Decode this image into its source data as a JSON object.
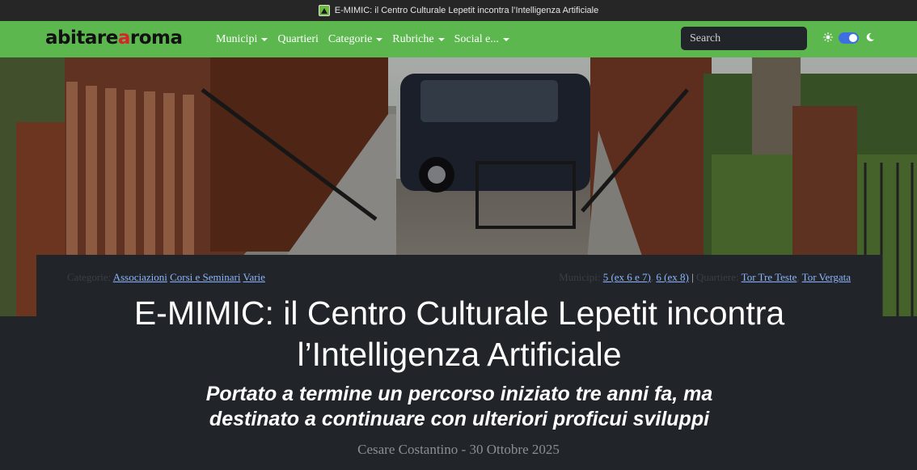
{
  "browser": {
    "tab_title": "E-MIMIC: il Centro Culturale Lepetit incontra l’Intelligenza Artificiale"
  },
  "navbar": {
    "logo_part1": "abitare",
    "logo_a": "a",
    "logo_part2": "roma",
    "items": [
      {
        "label": "Municipi",
        "dropdown": true
      },
      {
        "label": "Quartieri",
        "dropdown": false
      },
      {
        "label": "Categorie",
        "dropdown": true
      },
      {
        "label": "Rubriche",
        "dropdown": true
      },
      {
        "label": "Social e...",
        "dropdown": true
      }
    ],
    "search_placeholder": "Search",
    "theme_dark": true,
    "colors": {
      "bar": "#5cb84e",
      "logo_accent": "#d9232b",
      "toggle": "#3d6fe0"
    }
  },
  "article": {
    "categories_label": "Categorie:",
    "categories": [
      "Associazioni",
      "Corsi e Seminari",
      "Varie"
    ],
    "municipi_label": "Municipi:",
    "municipi": [
      "5 (ex 6 e 7)",
      "6 (ex 8)"
    ],
    "divider": "|",
    "quartieri_label": "Quartiere:",
    "quartieri": [
      "Tor Tre Teste",
      "Tor Vergata"
    ],
    "title": "E-MIMIC: il Centro Culturale Lepetit incontra l’Intelligenza Artificiale",
    "subtitle": "Portato a termine un percorso iniziato tre anni fa, ma destinato a continuare con ulteriori proficui sviluppi",
    "byline": "Cesare Costantino - 30 Ottobre 2025"
  }
}
